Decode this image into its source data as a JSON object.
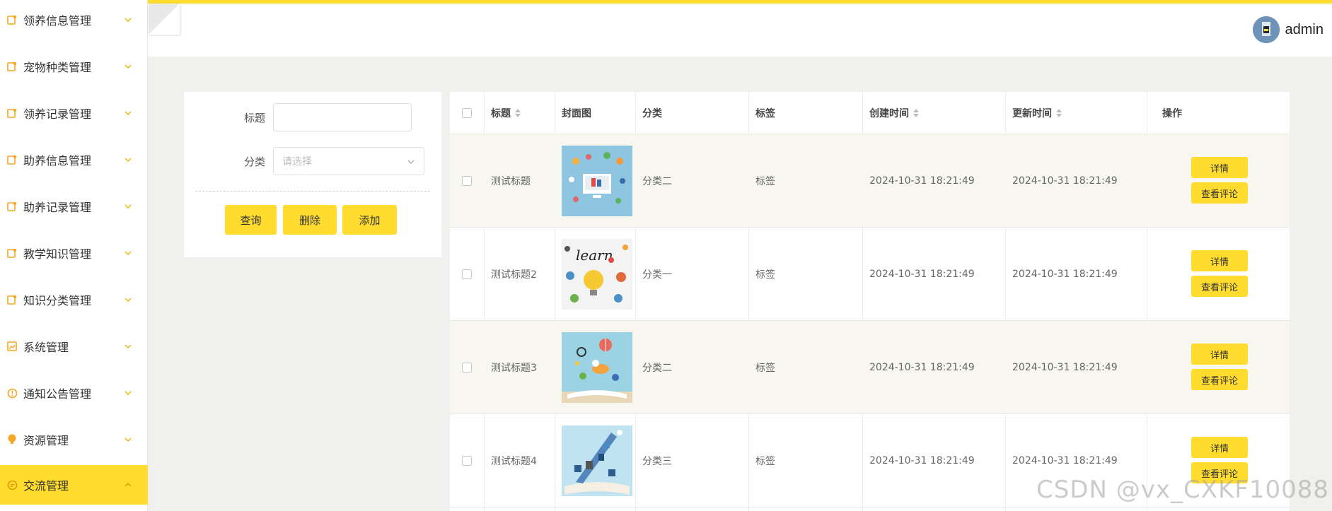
{
  "sidebar": {
    "items": [
      {
        "label": "领养信息管理",
        "icon": "doc-icon"
      },
      {
        "label": "宠物种类管理",
        "icon": "doc-icon"
      },
      {
        "label": "领养记录管理",
        "icon": "doc-icon"
      },
      {
        "label": "助养信息管理",
        "icon": "doc-icon"
      },
      {
        "label": "助养记录管理",
        "icon": "doc-icon"
      },
      {
        "label": "教学知识管理",
        "icon": "doc-icon"
      },
      {
        "label": "知识分类管理",
        "icon": "doc-icon"
      },
      {
        "label": "系统管理",
        "icon": "picture-icon"
      },
      {
        "label": "通知公告管理",
        "icon": "info-icon"
      },
      {
        "label": "资源管理",
        "icon": "bulb-icon"
      },
      {
        "label": "交流管理",
        "icon": "chat-icon",
        "active": true
      }
    ],
    "accent": "#ffdc2e"
  },
  "header": {
    "username": "admin"
  },
  "search": {
    "title_label": "标题",
    "title_value": "",
    "category_label": "分类",
    "category_placeholder": "请选择",
    "buttons": {
      "query": "查询",
      "delete": "删除",
      "add": "添加"
    }
  },
  "table": {
    "columns": [
      "标题",
      "封面图",
      "分类",
      "标签",
      "创建时间",
      "更新时间",
      "操作"
    ],
    "rows": [
      {
        "title": "测试标题",
        "category": "分类二",
        "tag": "标签",
        "created": "2024-10-31 18:21:49",
        "updated": "2024-10-31 18:21:49"
      },
      {
        "title": "测试标题2",
        "category": "分类一",
        "tag": "标签",
        "created": "2024-10-31 18:21:49",
        "updated": "2024-10-31 18:21:49"
      },
      {
        "title": "测试标题3",
        "category": "分类二",
        "tag": "标签",
        "created": "2024-10-31 18:21:49",
        "updated": "2024-10-31 18:21:49"
      },
      {
        "title": "测试标题4",
        "category": "分类三",
        "tag": "标签",
        "created": "2024-10-31 18:21:49",
        "updated": "2024-10-31 18:21:49"
      }
    ],
    "actions": {
      "detail": "详情",
      "comments": "查看评论"
    }
  },
  "watermark": "CSDN @vx_CXKF10088"
}
